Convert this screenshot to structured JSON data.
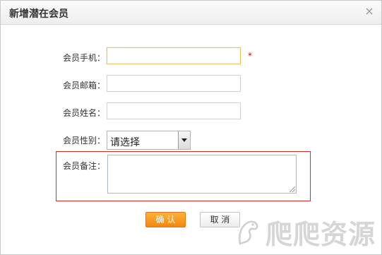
{
  "dialog": {
    "title": "新增潜在会员",
    "close_icon": "×"
  },
  "form": {
    "phone_label": "会员手机：",
    "phone_value": "",
    "required_mark": "*",
    "email_label": "会员邮箱：",
    "email_value": "",
    "name_label": "会员姓名：",
    "name_value": "",
    "gender_label": "会员性别：",
    "gender_selected": "请选择",
    "note_label": "会员备注：",
    "note_value": ""
  },
  "buttons": {
    "confirm": "确 认",
    "cancel": "取 消"
  },
  "watermark": {
    "text": "爬爬资源"
  },
  "colors": {
    "confirm_button": "#f0890f",
    "required": "#dd0000",
    "note_highlight": "#d42b2b",
    "focused_border": "#e7c46b"
  }
}
